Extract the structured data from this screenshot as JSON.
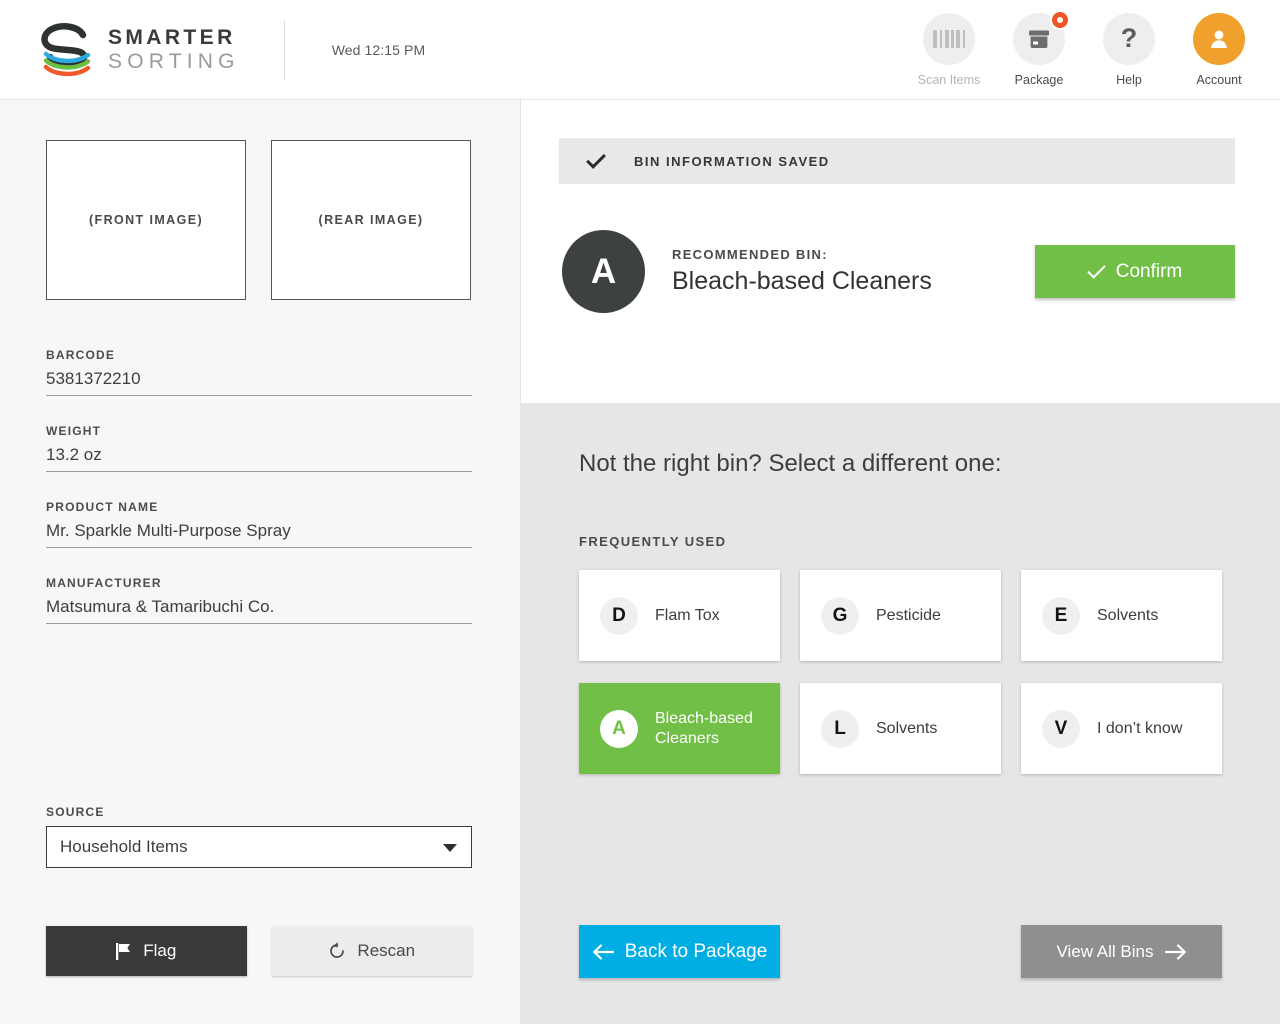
{
  "header": {
    "logo_line1": "SMARTER",
    "logo_line2": "SORTING",
    "clock": "Wed 12:15 PM",
    "actions": [
      {
        "label": "Scan Items",
        "icon": "barcode-icon",
        "disabled": true
      },
      {
        "label": "Package",
        "icon": "package-box-icon",
        "badge": true
      },
      {
        "label": "Help",
        "icon": "question-mark-icon"
      },
      {
        "label": "Account",
        "icon": "user-avatar-icon",
        "accent_color": "#f0a02c"
      }
    ]
  },
  "left_panel": {
    "front_image_placeholder": "(FRONT IMAGE)",
    "rear_image_placeholder": "(REAR IMAGE)",
    "fields": [
      {
        "label": "BARCODE",
        "value": "5381372210"
      },
      {
        "label": "WEIGHT",
        "value": "13.2 oz"
      },
      {
        "label": "PRODUCT NAME",
        "value": "Mr. Sparkle Multi-Purpose Spray"
      },
      {
        "label": "MANUFACTURER",
        "value": "Matsumura & Tamaribuchi Co."
      }
    ],
    "source": {
      "label": "SOURCE",
      "value": "Household Items"
    },
    "flag_button": "Flag",
    "rescan_button": "Rescan"
  },
  "right_panel": {
    "saved_banner": "BIN INFORMATION SAVED",
    "recommended_label": "RECOMMENDED BIN:",
    "recommended_letter": "A",
    "recommended_name": "Bleach-based Cleaners",
    "confirm_button": "Confirm",
    "prompt": "Not the right bin? Select a different one:",
    "frequently_used_label": "FREQUENTLY USED",
    "bins": [
      {
        "letter": "D",
        "name": "Flam Tox",
        "selected": false
      },
      {
        "letter": "G",
        "name": "Pesticide",
        "selected": false
      },
      {
        "letter": "E",
        "name": "Solvents",
        "selected": false
      },
      {
        "letter": "A",
        "name": "Bleach-based Cleaners",
        "selected": true
      },
      {
        "letter": "L",
        "name": "Solvents",
        "selected": false
      },
      {
        "letter": "V",
        "name": "I don’t know",
        "selected": false
      }
    ],
    "back_button": "Back to Package",
    "view_all_button": "View All Bins"
  },
  "colors": {
    "green": "#72bf48",
    "blue": "#00aee4",
    "orange": "#f0a02c",
    "red_badge": "#ec5526",
    "dark": "#3e423f",
    "gray_button": "#8f8f8f"
  }
}
